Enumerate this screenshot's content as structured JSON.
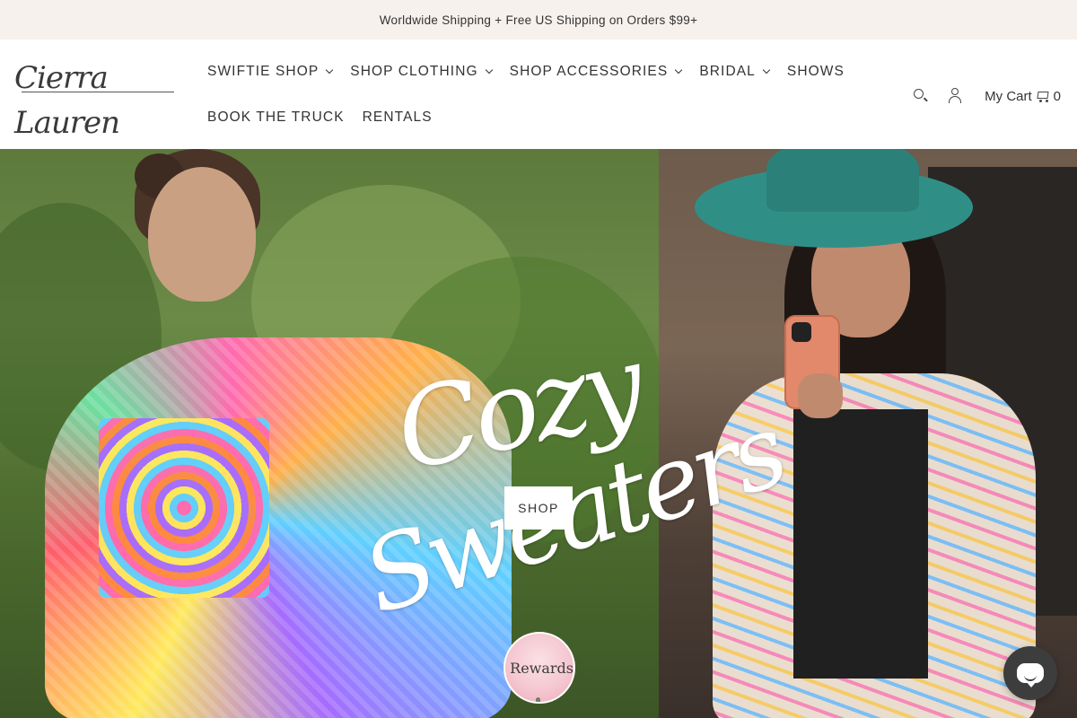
{
  "announcement": {
    "text": "Worldwide Shipping + Free US Shipping on Orders $99+"
  },
  "brand": {
    "logo_text": "Cierra Lauren"
  },
  "nav": {
    "row1": [
      {
        "label": "SWIFTIE SHOP",
        "dropdown": true
      },
      {
        "label": "SHOP CLOTHING",
        "dropdown": true
      },
      {
        "label": "SHOP ACCESSORIES",
        "dropdown": true
      },
      {
        "label": "BRIDAL",
        "dropdown": true
      },
      {
        "label": "SHOWS",
        "dropdown": false
      }
    ],
    "row2": [
      {
        "label": "BOOK THE TRUCK",
        "dropdown": false
      },
      {
        "label": "RENTALS",
        "dropdown": false
      }
    ]
  },
  "header_icons": {
    "search": "search-icon",
    "account": "user-icon",
    "cart_label": "My Cart",
    "cart_count": "0",
    "cart_icon": "cart-icon"
  },
  "hero": {
    "title_line1": "Cozy",
    "title_line2": "Sweaters",
    "shop_label": "SHOP"
  },
  "rewards": {
    "label": "Rewards"
  },
  "chat": {
    "icon": "chat-icon"
  },
  "colors": {
    "announcement_bg": "#f6f1ed",
    "chat_bg": "#3d3d3d",
    "hat": "#2f8f87"
  }
}
